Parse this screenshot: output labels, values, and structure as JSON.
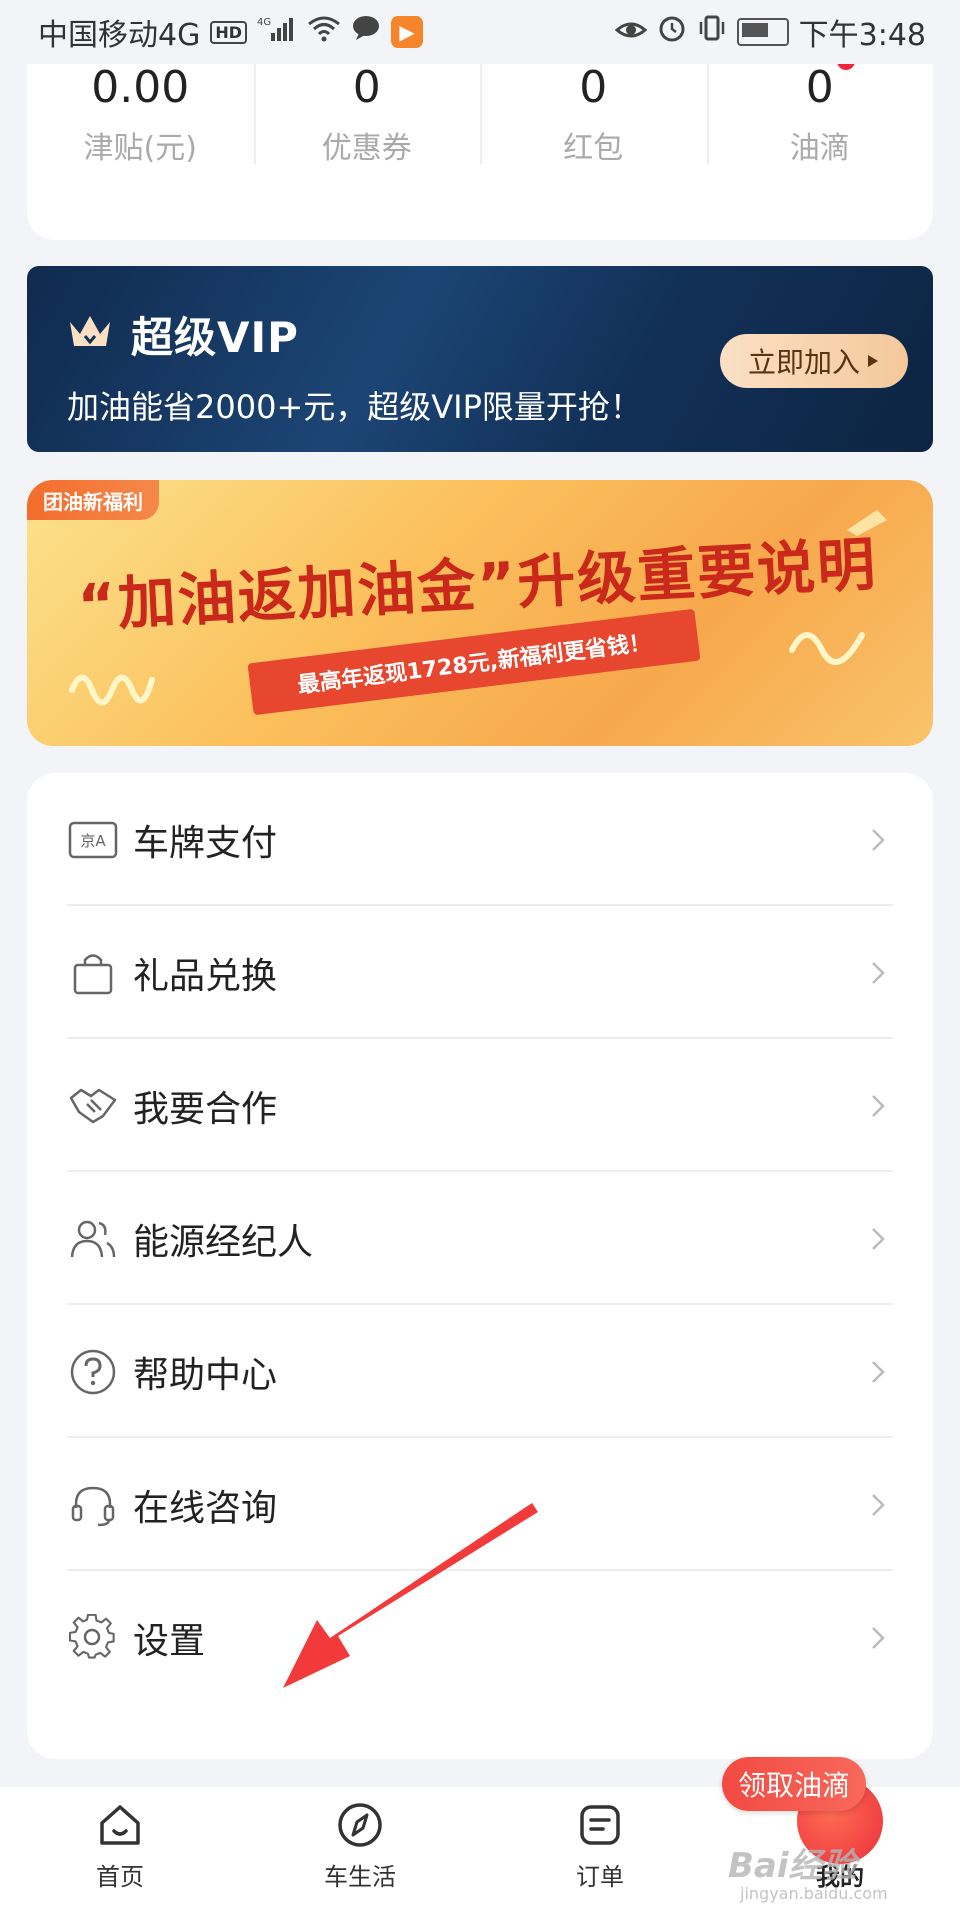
{
  "status_bar": {
    "carrier": "中国移动4G",
    "hd": "HD",
    "net": "4G",
    "time": "下午3:48"
  },
  "stats": [
    {
      "value": "0.00",
      "label": "津贴(元)"
    },
    {
      "value": "0",
      "label": "优惠券"
    },
    {
      "value": "0",
      "label": "红包"
    },
    {
      "value": "0",
      "label": "油滴"
    }
  ],
  "vip_banner": {
    "title": "超级VIP",
    "description": "加油能省2000+元，超级VIP限量开抢！",
    "button": "立即加入"
  },
  "promo_banner": {
    "tag": "团油新福利",
    "title": "“加油返加油金”升级重要说明",
    "subtitle": "最高年返现1728元,新福利更省钱！"
  },
  "menu": [
    {
      "label": "车牌支付",
      "icon": "license-plate-icon",
      "icon_text": "京A"
    },
    {
      "label": "礼品兑换",
      "icon": "shopping-bag-icon"
    },
    {
      "label": "我要合作",
      "icon": "handshake-icon"
    },
    {
      "label": "能源经纪人",
      "icon": "users-icon"
    },
    {
      "label": "帮助中心",
      "icon": "help-circle-icon"
    },
    {
      "label": "在线咨询",
      "icon": "headset-icon"
    },
    {
      "label": "设置",
      "icon": "gear-icon"
    }
  ],
  "tabs": [
    {
      "label": "首页",
      "icon": "home-icon"
    },
    {
      "label": "车生活",
      "icon": "compass-icon"
    },
    {
      "label": "订单",
      "icon": "order-icon"
    },
    {
      "label": "我的",
      "icon": "profile-icon",
      "active": true
    }
  ],
  "claim_badge": "领取油滴",
  "watermark": {
    "brand": "Bai经验",
    "url": "jingyan.baidu.com"
  },
  "colors": {
    "accent_red": "#f0243a",
    "vip_navy": "#123158",
    "vip_gold": "#f3c89b",
    "promo_orange": "#f7a84c",
    "page_bg": "#f3f4f8",
    "annotation_arrow": "#f23a3a"
  }
}
